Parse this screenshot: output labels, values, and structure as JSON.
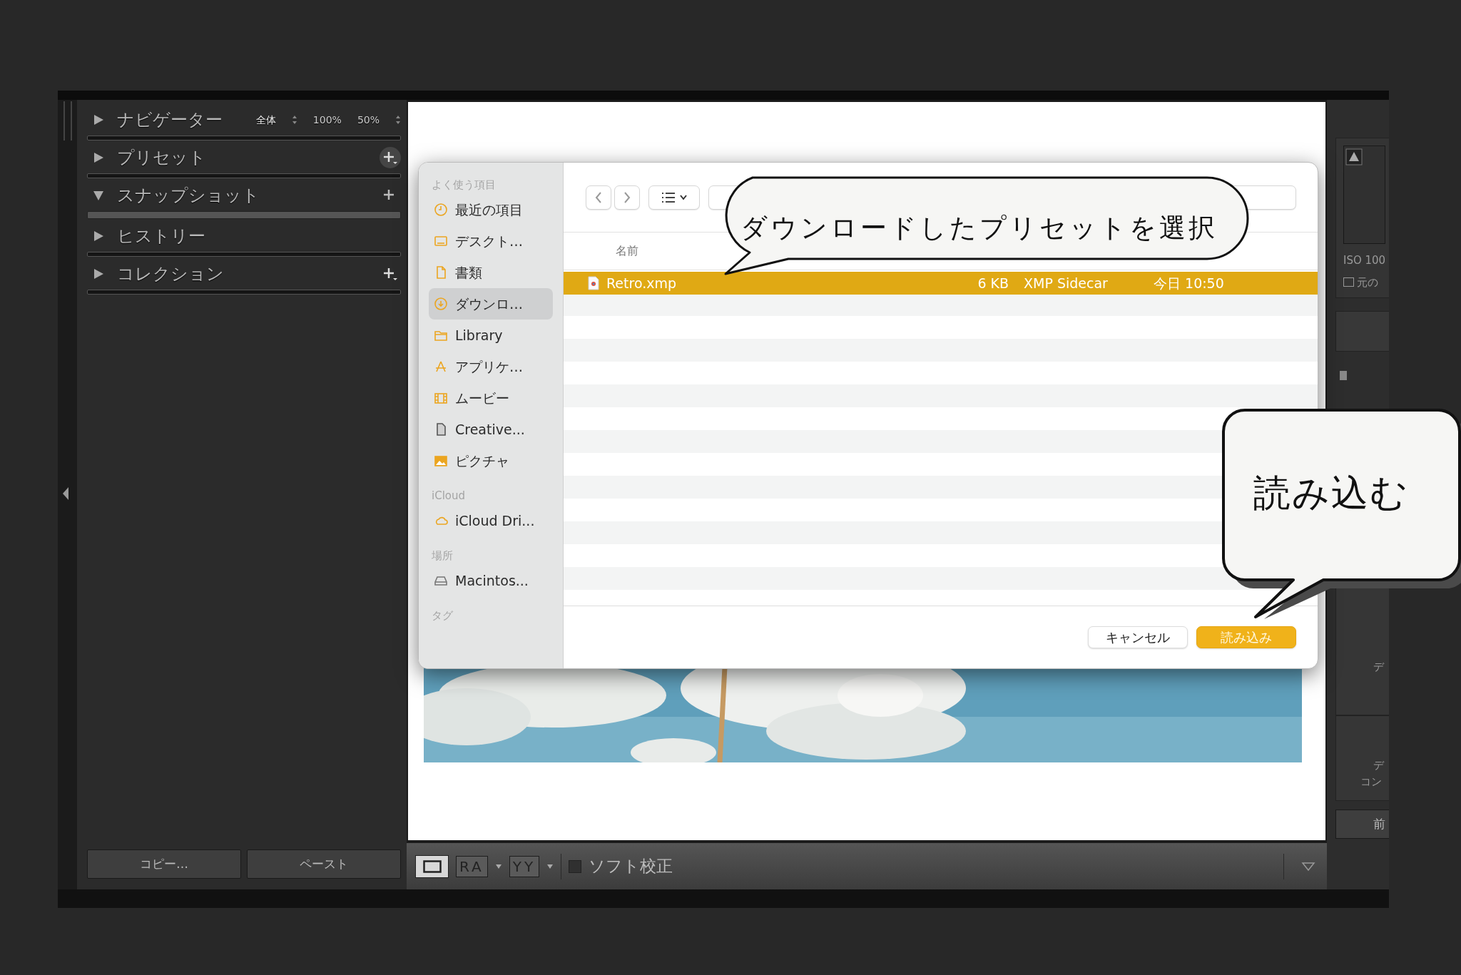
{
  "left_panel": {
    "sections": [
      {
        "kind": "zoom",
        "label": "ナビゲーター",
        "expanded": false,
        "highlighted": false,
        "zoom_options": [
          "全体",
          "100%",
          "50%"
        ]
      },
      {
        "kind": "add-menu",
        "label": "プリセット",
        "expanded": false,
        "highlighted": true
      },
      {
        "kind": "add",
        "label": "スナップショット",
        "expanded": true,
        "highlighted": false
      },
      {
        "kind": "plain",
        "label": "ヒストリー",
        "expanded": false,
        "highlighted": false
      },
      {
        "kind": "add-menu",
        "label": "コレクション",
        "expanded": false,
        "highlighted": false
      }
    ],
    "buttons": [
      "コピー…",
      "ペースト"
    ]
  },
  "toolbar": {
    "view_buttons": [
      "RA",
      "YY"
    ],
    "soft_proof": {
      "label": "ソフト校正",
      "checked": false
    }
  },
  "right_panel": {
    "iso": "ISO 100",
    "original_label": "元の",
    "original_checked": false,
    "texts": [
      "デ",
      "デ",
      "コン"
    ],
    "button": "前"
  },
  "dialog": {
    "sidebar": [
      {
        "heading": "よく使う項目",
        "items": [
          {
            "label": "最近の項目",
            "selected": false
          },
          {
            "label": "デスクト…",
            "selected": false
          },
          {
            "label": "書類",
            "selected": false
          },
          {
            "label": "ダウンロ…",
            "selected": true
          },
          {
            "label": "Library",
            "selected": false
          },
          {
            "label": "アプリケ…",
            "selected": false
          },
          {
            "label": "ムービー",
            "selected": false
          },
          {
            "label": "Creative...",
            "selected": false
          },
          {
            "label": "ピクチャ",
            "selected": false
          }
        ]
      },
      {
        "heading": "iCloud",
        "items": [
          {
            "label": "iCloud Dri...",
            "selected": false
          }
        ]
      },
      {
        "heading": "場所",
        "items": [
          {
            "label": "Macintos...",
            "selected": false
          }
        ]
      },
      {
        "heading": "タグ"
      }
    ],
    "column_header": "名前",
    "files": [
      {
        "name": "Retro.xmp",
        "size": "6 KB",
        "type": "XMP Sidecar",
        "date": "今日 10:50",
        "selected": true
      }
    ],
    "buttons": [
      {
        "label": "キャンセル",
        "primary": false
      },
      {
        "label": "読み込み",
        "primary": true
      }
    ]
  },
  "callouts": [
    {
      "text": "ダウンロードしたプリセットを選択"
    },
    {
      "text": "読み込む"
    }
  ]
}
